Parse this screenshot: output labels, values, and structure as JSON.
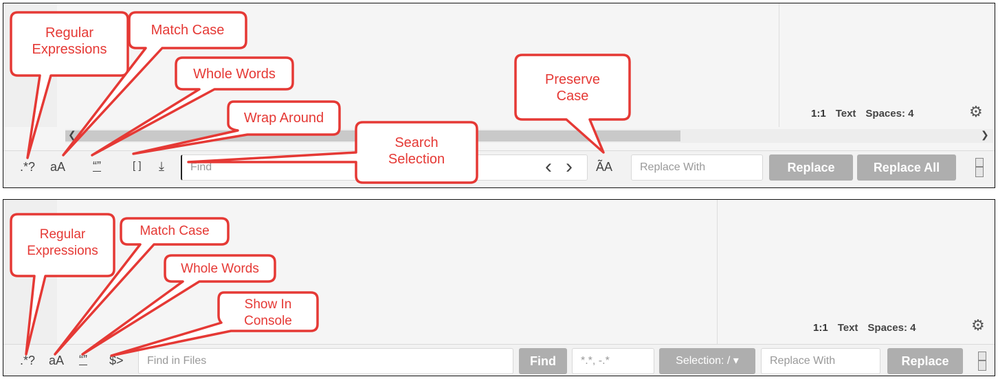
{
  "panel1": {
    "status": {
      "position": "1:1",
      "mode": "Text",
      "spaces": "Spaces: 4"
    },
    "icons": {
      "regex": ".*?",
      "case": "aA",
      "words": "“”",
      "wrap": "[ ]",
      "selection": "⤓"
    },
    "find_placeholder": "Find",
    "prev_icon": "‹",
    "next_icon": "›",
    "preserve_icon": "ÃA",
    "replace_placeholder": "Replace With",
    "replace_label": "Replace",
    "replace_all_label": "Replace All",
    "callouts": {
      "regex": "Regular\nExpressions",
      "match_case": "Match Case",
      "whole_words": "Whole Words",
      "wrap_around": "Wrap Around",
      "search_selection": "Search\nSelection",
      "preserve_case": "Preserve\nCase"
    }
  },
  "panel2": {
    "status": {
      "position": "1:1",
      "mode": "Text",
      "spaces": "Spaces: 4"
    },
    "icons": {
      "regex": ".*?",
      "case": "aA",
      "words": "“”",
      "console": "$>"
    },
    "find_placeholder": "Find in Files",
    "find_label": "Find",
    "exclude_placeholder": "*.*, -.*",
    "selection_label": "Selection: / ▾",
    "replace_placeholder": "Replace With",
    "replace_label": "Replace",
    "callouts": {
      "regex": "Regular\nExpressions",
      "match_case": "Match Case",
      "whole_words": "Whole Words",
      "show_console": "Show In\nConsole"
    }
  },
  "colors": {
    "callout": "#e53935",
    "button": "#aeaeae"
  }
}
